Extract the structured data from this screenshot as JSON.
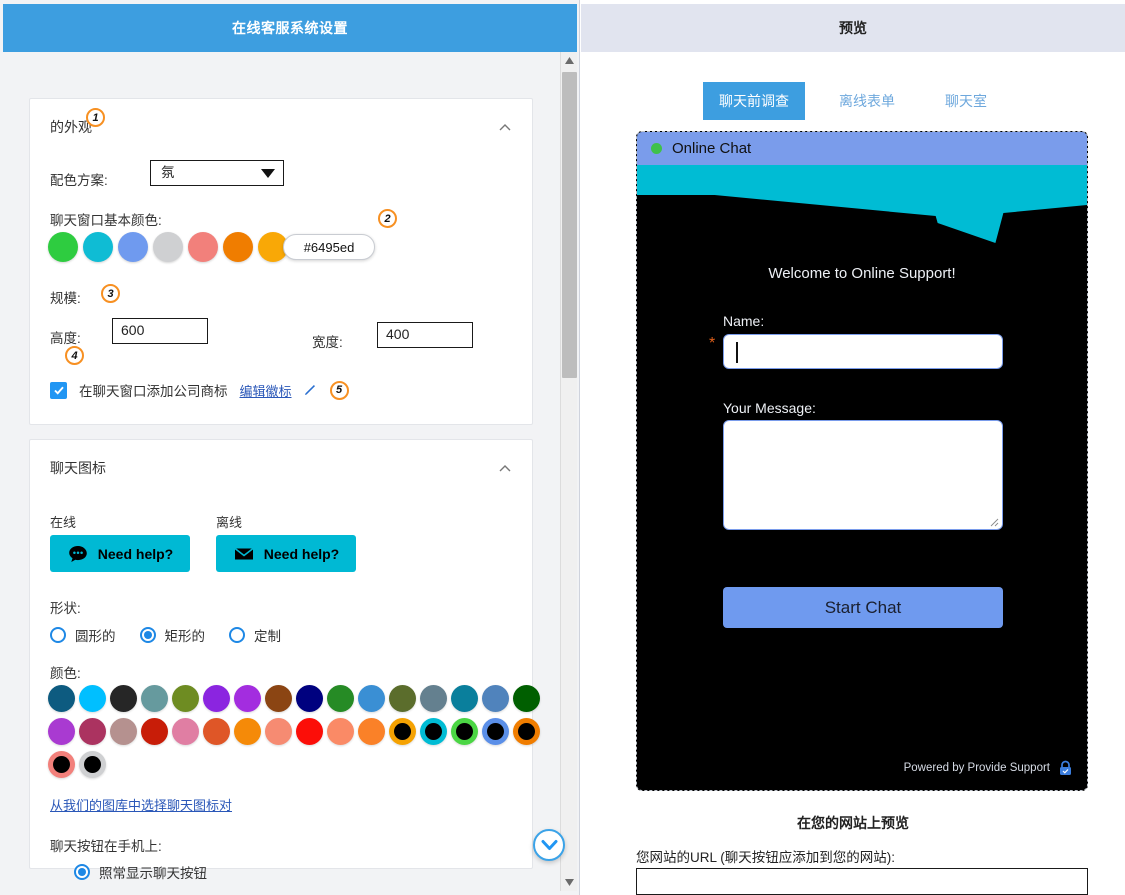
{
  "left": {
    "header_title": "在线客服系统设置",
    "appearance": {
      "title": "的外观",
      "scheme_label": "配色方案:",
      "scheme_value": "氛",
      "base_color_label": "聊天窗口基本颜色:",
      "base_swatches": [
        "#2ecc40",
        "#0fbcd4",
        "#6f9aef",
        "#cfd0d2",
        "#f2807b",
        "#f07d00",
        "#f9a806"
      ],
      "hex_value": "#6495ed",
      "hex_swatch": "#6f9aef",
      "size_label": "规模:",
      "height_label": "高度:",
      "height_value": "600",
      "width_label": "宽度:",
      "width_value": "400",
      "logo_checkbox_label": "在聊天窗口添加公司商标",
      "edit_logo_link": "编辑徽标",
      "badges": [
        "1",
        "2",
        "3",
        "4",
        "5"
      ]
    },
    "chat_icon": {
      "title": "聊天图标",
      "online_label": "在线",
      "offline_label": "离线",
      "online_button_text": "Need help?",
      "offline_button_text": "Need help?",
      "button_color": "#00b9d4",
      "shape_label": "形状:",
      "shape_options": [
        {
          "label": "圆形的",
          "selected": false
        },
        {
          "label": "矩形的",
          "selected": true
        },
        {
          "label": "定制",
          "selected": false
        }
      ],
      "colors_label": "颜色:",
      "color_swatches": [
        {
          "color": "#0d5b80",
          "ring": false
        },
        {
          "color": "#00bfff",
          "ring": false
        },
        {
          "color": "#262626",
          "ring": false
        },
        {
          "color": "#669a9e",
          "ring": false
        },
        {
          "color": "#6e8c22",
          "ring": false
        },
        {
          "color": "#8b25e0",
          "ring": false
        },
        {
          "color": "#a32ddf",
          "ring": false
        },
        {
          "color": "#8b4513",
          "ring": false
        },
        {
          "color": "#00017f",
          "ring": false
        },
        {
          "color": "#268b25",
          "ring": false
        },
        {
          "color": "#3a8fd4",
          "ring": false
        },
        {
          "color": "#5b6d2c",
          "ring": false
        },
        {
          "color": "#64808f",
          "ring": false
        },
        {
          "color": "#0a7f9c",
          "ring": false
        },
        {
          "color": "#5083bc",
          "ring": false
        },
        {
          "color": "#005f00",
          "ring": false
        },
        {
          "color": "#a93ad1",
          "ring": false
        },
        {
          "color": "#ab3360",
          "ring": false
        },
        {
          "color": "#b5918f",
          "ring": false
        },
        {
          "color": "#c81d08",
          "ring": false
        },
        {
          "color": "#e07ea3",
          "ring": false
        },
        {
          "color": "#df5627",
          "ring": false
        },
        {
          "color": "#f58a08",
          "ring": false
        },
        {
          "color": "#f68b72",
          "ring": false
        },
        {
          "color": "#fc0e08",
          "ring": false
        },
        {
          "color": "#fa8a66",
          "ring": false
        },
        {
          "color": "#fa8128",
          "ring": false
        },
        {
          "color": "#f5a202",
          "ring": true
        },
        {
          "color": "#00bcd4",
          "ring": true
        },
        {
          "color": "#4bd644",
          "ring": true
        },
        {
          "color": "#5b8fe8",
          "ring": true
        },
        {
          "color": "#f07d00",
          "ring": true
        },
        {
          "color": "#f2807b",
          "ring": true
        },
        {
          "color": "#cfd0d2",
          "ring": true
        }
      ],
      "gallery_link": "从我们的图库中选择聊天图标对",
      "mobile_label": "聊天按钮在手机上:",
      "mobile_option": "照常显示聊天按钮"
    }
  },
  "right": {
    "header_title": "预览",
    "tabs": [
      {
        "label": "聊天前调查",
        "active": true
      },
      {
        "label": "离线表单",
        "active": false
      },
      {
        "label": "聊天室",
        "active": false
      }
    ],
    "chat_window": {
      "title": "Online Chat",
      "status_color": "#3fc14a",
      "header_color": "#7a9ceb",
      "banner_color": "#00bcd4",
      "welcome_text": "Welcome to Online Support!",
      "name_label": "Name:",
      "name_value": "",
      "required_mark": "*",
      "message_label": "Your Message:",
      "message_value": "",
      "start_button": "Start Chat",
      "footer_text": "Powered by Provide Support"
    },
    "site_preview": {
      "title": "在您的网站上预览",
      "url_label": "您网站的URL (聊天按钮应添加到您的网站):",
      "url_value": ""
    }
  }
}
